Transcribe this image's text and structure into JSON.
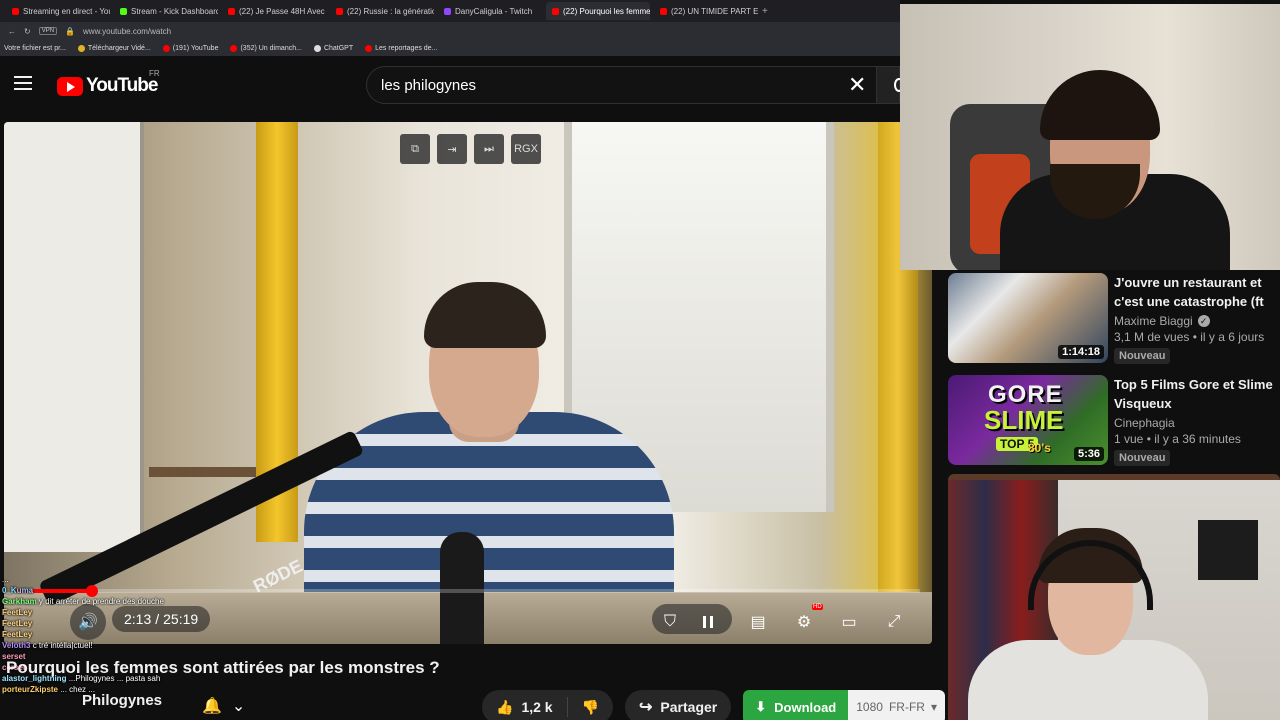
{
  "browser": {
    "tabs": [
      {
        "label": "Streaming en direct - YouTube",
        "color": "#ff0000",
        "active": false
      },
      {
        "label": "Stream - Kick Dashboard",
        "color": "#53fc18",
        "active": false
      },
      {
        "label": "(22) Je Passe 48H Avec L...",
        "color": "#ff0000",
        "active": false
      },
      {
        "label": "(22) Russie : la génération...",
        "color": "#ff0000",
        "active": false
      },
      {
        "label": "DanyCaligula - Twitch",
        "color": "#9146ff",
        "active": false
      },
      {
        "label": "(22) Pourquoi les femmes...",
        "color": "#ff0000",
        "active": true
      },
      {
        "label": "(22) UN TIMIDE PART EN R...",
        "color": "#ff0000",
        "active": false
      }
    ],
    "new_tab": "+",
    "vpn": "VPN",
    "url": "www.youtube.com/watch",
    "bookmarks": [
      {
        "label": "Votre fichier est pr...",
        "color": ""
      },
      {
        "label": "Téléchargeur Vidé...",
        "color": "#e0b420"
      },
      {
        "label": "(191) YouTube",
        "color": "#ff0000"
      },
      {
        "label": "(352) Un dimanch...",
        "color": "#ff0000"
      },
      {
        "label": "ChatGPT",
        "color": "#dddddd"
      },
      {
        "label": "Les reportages de...",
        "color": "#ff0000"
      }
    ]
  },
  "header": {
    "logo_text": "YouTube",
    "country": "FR",
    "search_value": "les philogynes",
    "clear": "✕"
  },
  "player": {
    "ext_buttons": [
      "⧉",
      "⇥",
      "⏭",
      "RGX"
    ],
    "mic_brand": "RØDE",
    "time_current": "2:13",
    "time_separator": "/",
    "time_total": "25:19",
    "progress_fraction": 0.084,
    "hd_badge": "HD"
  },
  "chat": [
    {
      "user": "",
      "text": "..."
    },
    {
      "user": "0_Kuma",
      "text": ""
    },
    {
      "user": "Garkham",
      "text": "y dit arrêter de prendre des douche"
    },
    {
      "user": "FeetLey",
      "text": ""
    },
    {
      "user": "FeetLey",
      "text": ""
    },
    {
      "user": "FeetLey",
      "text": ""
    },
    {
      "user": "Veloth3",
      "text": "c tré intélla|ctuel!"
    },
    {
      "user": "serset",
      "text": ""
    },
    {
      "user": "cerset",
      "text": ""
    },
    {
      "user": "alastor_lightning",
      "text": "...Philogynes ... pasta sah"
    },
    {
      "user": "porteurZkipste",
      "text": "... chez ..."
    }
  ],
  "video": {
    "title": "Pourquoi les femmes sont attirées par les monstres ?",
    "channel": "Philogynes",
    "likes": "1,2 k",
    "share_label": "Partager",
    "download_label": "Download",
    "download_quality": "1080",
    "download_lang": "FR-FR"
  },
  "recommendations": [
    {
      "title": "J'ouvre un restaurant et c'est une catastrophe (ft Djilsi, ...",
      "channel": "Maxime Biaggi",
      "verified": true,
      "meta": "3,1 M de vues • il y a 6 jours",
      "badge": "Nouveau",
      "duration": "1:14:18"
    },
    {
      "title": "Top 5 Films Gore et Slime Visqueux",
      "channel": "Cinephagia",
      "verified": false,
      "meta": "1 vue • il y a 36 minutes",
      "badge": "Nouveau",
      "duration": "5:36",
      "thumb_text": {
        "gore": "GORE",
        "slime": "SLIME",
        "top": "TOP 5",
        "era": "80's"
      }
    }
  ],
  "icons": {
    "like": "👍",
    "dislike": "👎",
    "share": "↪",
    "download": "⬇",
    "bell": "🔔",
    "chevron": "⌄",
    "volume": "🔊",
    "settings": "⚙",
    "fullscreen": "⤢",
    "theater": "▭",
    "subtitles": "▤",
    "dropdown": "▾"
  },
  "colors": {
    "accent": "#ff0000",
    "download": "#2ba640",
    "background": "#0f0f0f"
  }
}
